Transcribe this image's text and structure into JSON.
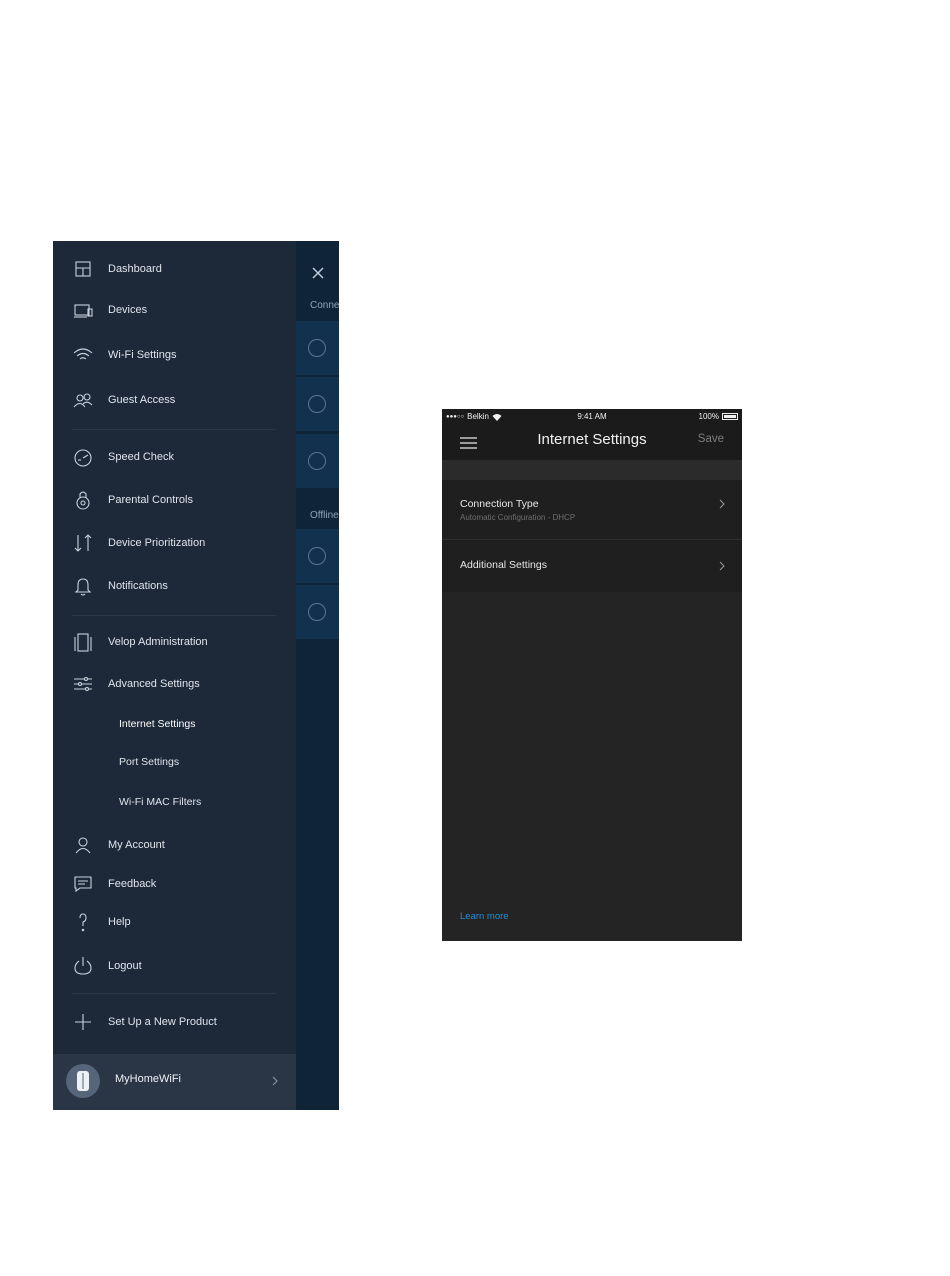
{
  "menu": {
    "items": [
      {
        "label": "Dashboard",
        "icon": "dashboard-icon"
      },
      {
        "label": "Devices",
        "icon": "devices-icon"
      },
      {
        "label": "Wi-Fi Settings",
        "icon": "wifi-icon"
      },
      {
        "label": "Guest Access",
        "icon": "guest-access-icon"
      },
      {
        "label": "Speed Check",
        "icon": "speed-check-icon"
      },
      {
        "label": "Parental Controls",
        "icon": "parental-controls-icon"
      },
      {
        "label": "Device Prioritization",
        "icon": "device-prioritization-icon"
      },
      {
        "label": "Notifications",
        "icon": "bell-icon"
      },
      {
        "label": "Velop Administration",
        "icon": "velop-icon"
      },
      {
        "label": "Advanced Settings",
        "icon": "sliders-icon"
      },
      {
        "label": "Internet Settings"
      },
      {
        "label": "Port Settings"
      },
      {
        "label": "Wi-Fi MAC Filters"
      },
      {
        "label": "My Account",
        "icon": "user-icon"
      },
      {
        "label": "Feedback",
        "icon": "feedback-icon"
      },
      {
        "label": "Help",
        "icon": "help-icon"
      },
      {
        "label": "Logout",
        "icon": "power-icon"
      },
      {
        "label": "Set Up a New Product",
        "icon": "plus-icon"
      }
    ],
    "network_name": "MyHomeWiFi"
  },
  "background_panel": {
    "section_connected": "Conne",
    "section_offline": "Offline"
  },
  "phone": {
    "status": {
      "carrier_dots": "●●●○○",
      "carrier": "Belkin",
      "time": "9:41 AM",
      "battery": "100%"
    },
    "nav": {
      "title": "Internet Settings",
      "save_label": "Save"
    },
    "rows": [
      {
        "title": "Connection Type",
        "subtitle": "Automatic Configuration - DHCP"
      },
      {
        "title": "Additional Settings"
      }
    ],
    "learn_more": "Learn more"
  },
  "colors": {
    "drawer_bg": "#1d2838",
    "phone_bg": "#242424",
    "link": "#1f8fd6"
  }
}
